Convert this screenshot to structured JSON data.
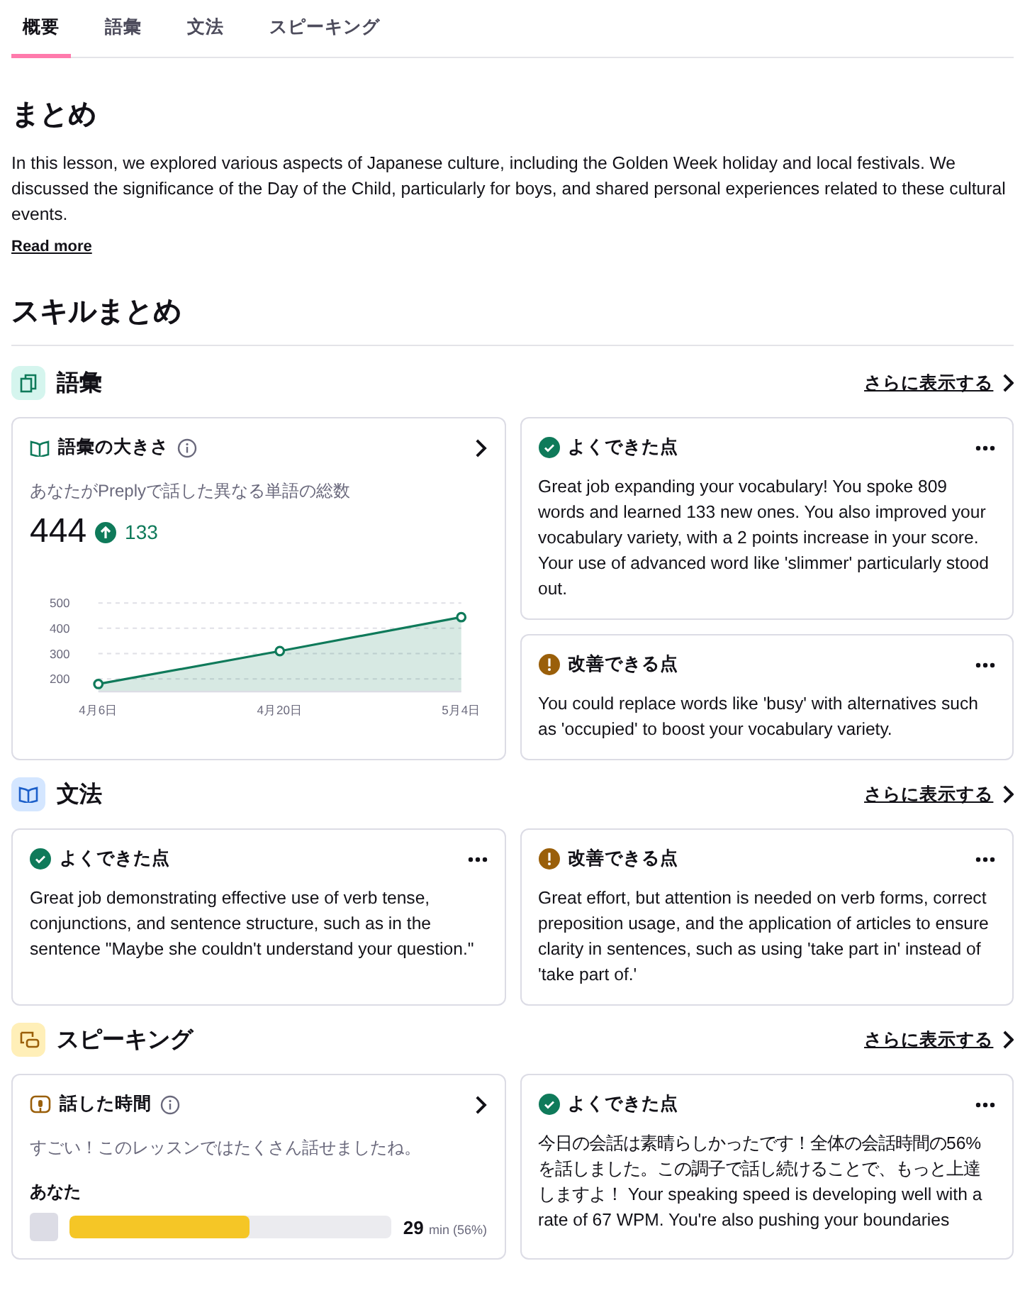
{
  "tabs": [
    {
      "label": "概要",
      "selected": true
    },
    {
      "label": "語彙",
      "selected": false
    },
    {
      "label": "文法",
      "selected": false
    },
    {
      "label": "スピーキング",
      "selected": false
    }
  ],
  "summary": {
    "title": "まとめ",
    "body": "In this lesson, we explored various aspects of Japanese culture, including the Golden Week holiday and local festivals. We discussed the significance of the Day of the Child, particularly for boys, and shared personal experiences related to these cultural events.",
    "read_more": "Read more"
  },
  "skills_title": "スキルまとめ",
  "skills": [
    {
      "kind": "vocabulary",
      "title": "語彙",
      "more_link": "さらに表示する",
      "columns": [
        [
          {
            "kind": "metric",
            "title": "語彙の大きさ",
            "subtitle": "あなたがPreplyで話した異なる単語の総数",
            "value": "444",
            "delta": "133",
            "chart_data": {
              "type": "area",
              "categories": [
                "4月6日",
                "4月20日",
                "5月4日"
              ],
              "values": [
                180,
                310,
                444
              ],
              "color": "#0f7a5a",
              "grid": true,
              "ylim": [
                150,
                500
              ],
              "yticks": [
                200,
                300,
                400,
                500
              ]
            }
          }
        ],
        [
          {
            "kind": "good",
            "title": "よくできた点",
            "body": "Great job expanding your vocabulary! You spoke 809 words and learned 133 new ones. You also improved your vocabulary variety, with a 2 points increase in your score. Your use of advanced word like 'slimmer' particularly stood out."
          },
          {
            "kind": "improve",
            "title": "改善できる点",
            "body": "You could replace words like 'busy' with alternatives such as 'occupied' to boost your vocabulary variety."
          }
        ]
      ]
    },
    {
      "kind": "grammar",
      "title": "文法",
      "more_link": "さらに表示する",
      "columns": [
        [
          {
            "kind": "good",
            "title": "よくできた点",
            "body": "Great job demonstrating effective use of verb tense, conjunctions, and sentence structure, such as in the sentence \"Maybe she couldn't understand your question.\""
          }
        ],
        [
          {
            "kind": "improve",
            "title": "改善できる点",
            "body": "Great effort, but attention is needed on verb forms, correct preposition usage, and the application of articles to ensure clarity in sentences, such as using 'take part in' instead of 'take part of.'"
          }
        ]
      ]
    },
    {
      "kind": "speaking",
      "title": "スピーキング",
      "more_link": "さらに表示する",
      "columns": [
        [
          {
            "kind": "talk_time",
            "title": "話した時間",
            "subtitle": "すごい！このレッスンではたくさん話せましたね。",
            "speaker": "あなた",
            "level": 0.56,
            "reading": "29",
            "unit": "min",
            "percent": "(56%)"
          }
        ],
        [
          {
            "kind": "good",
            "title": "よくできた点",
            "body": "今日の会話は素晴らしかったです！全体の会話時間の56%を話しました。この調子で話し続けることで、もっと上達しますよ！ Your speaking speed is developing well with a rate of 67 WPM. You're also pushing your boundaries"
          }
        ]
      ]
    }
  ]
}
